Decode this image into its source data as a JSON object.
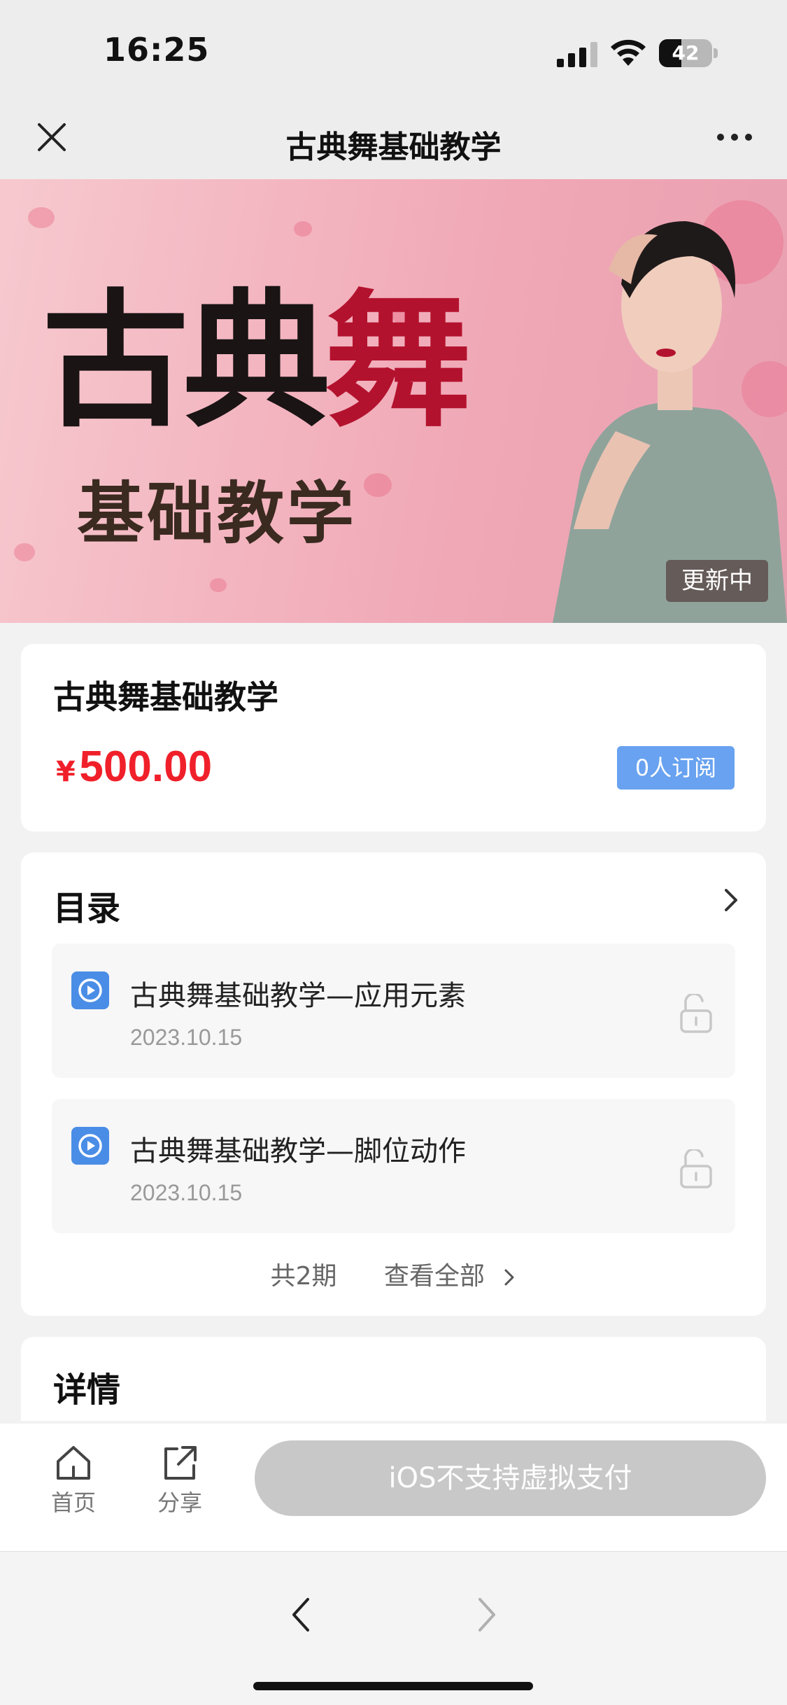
{
  "status_bar": {
    "time": "16:25",
    "battery": "42",
    "battery_level": 0.42
  },
  "nav": {
    "title": "古典舞基础教学",
    "close_icon": "close-icon",
    "more_icon": "more-icon"
  },
  "hero": {
    "title_left": "古典",
    "title_accent": "舞",
    "subtitle": "基础教学",
    "badge": "更新中"
  },
  "course": {
    "title": "古典舞基础教学",
    "currency": "¥",
    "price": "500.00",
    "subscribers": "0人订阅"
  },
  "toc": {
    "heading": "目录",
    "items": [
      {
        "title": "古典舞基础教学—应用元素",
        "date": "2023.10.15"
      },
      {
        "title": "古典舞基础教学—脚位动作",
        "date": "2023.10.15"
      }
    ],
    "count": "共2期",
    "view_all": "查看全部"
  },
  "detail": {
    "heading": "详情"
  },
  "bottom_bar": {
    "home_label": "首页",
    "share_label": "分享",
    "pay_label": "iOS不支持虚拟支付"
  },
  "colors": {
    "price": "#f0202a",
    "badge_blue": "#68a2f0",
    "play_blue": "#4a8de6",
    "pay_disabled": "#c8c8c8"
  }
}
